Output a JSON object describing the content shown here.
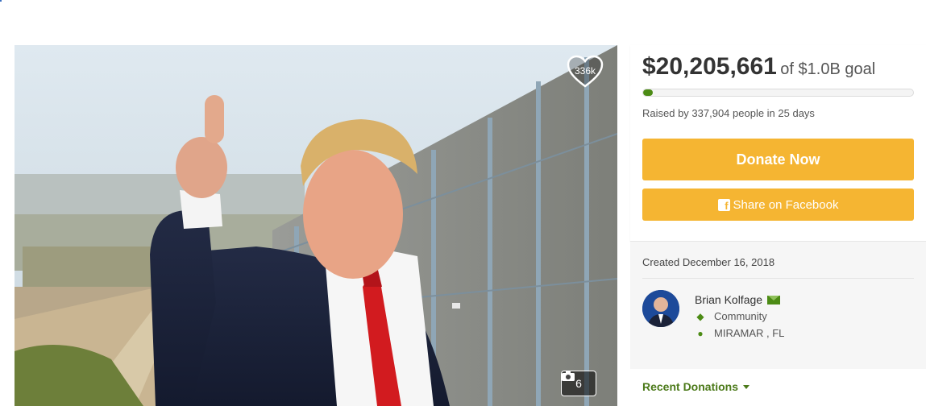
{
  "campaign": {
    "amount_raised": "$20,205,661",
    "goal_text": "of $1.0B goal",
    "progress_fraction": 0.02,
    "raised_by_text": "Raised by 337,904 people in 25 days",
    "donate_label": "Donate Now",
    "share_label": "Share on Facebook",
    "hearts": "336k",
    "photo_count": "6"
  },
  "details": {
    "created_text": "Created December 16, 2018",
    "organizer_name": "Brian Kolfage",
    "category": "Community",
    "location": "MIRAMAR , FL"
  },
  "recent_donations_label": "Recent Donations",
  "icons": {
    "heart": "heart-icon",
    "camera": "camera-icon",
    "facebook": "facebook-icon",
    "mail": "mail-icon",
    "tag": "tag-icon",
    "pin": "map-pin-icon"
  },
  "colors": {
    "accent": "#f5b532",
    "progress": "#4c8b15",
    "link_green": "#4c7a1a"
  }
}
